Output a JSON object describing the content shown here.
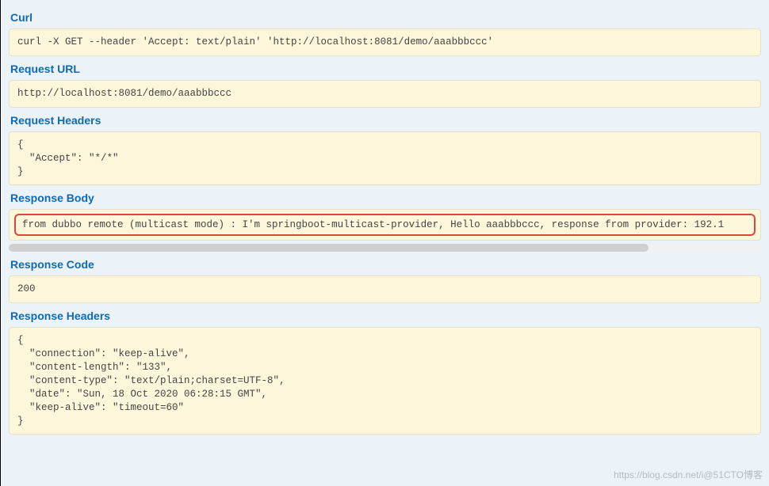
{
  "sections": {
    "curl": {
      "title": "Curl",
      "content": "curl -X GET --header 'Accept: text/plain' 'http://localhost:8081/demo/aaabbbccc'"
    },
    "requestUrl": {
      "title": "Request URL",
      "content": "http://localhost:8081/demo/aaabbbccc"
    },
    "requestHeaders": {
      "title": "Request Headers",
      "content": "{\n  \"Accept\": \"*/*\"\n}"
    },
    "responseBody": {
      "title": "Response Body",
      "content": "from dubbo remote (multicast mode) : I'm springboot-multicast-provider, Hello aaabbbccc, response from provider: 192.1"
    },
    "responseCode": {
      "title": "Response Code",
      "content": "200"
    },
    "responseHeaders": {
      "title": "Response Headers",
      "content": "{\n  \"connection\": \"keep-alive\",\n  \"content-length\": \"133\",\n  \"content-type\": \"text/plain;charset=UTF-8\",\n  \"date\": \"Sun, 18 Oct 2020 06:28:15 GMT\",\n  \"keep-alive\": \"timeout=60\"\n}"
    }
  },
  "watermark": "https://blog.csdn.net/i@51CTO博客"
}
